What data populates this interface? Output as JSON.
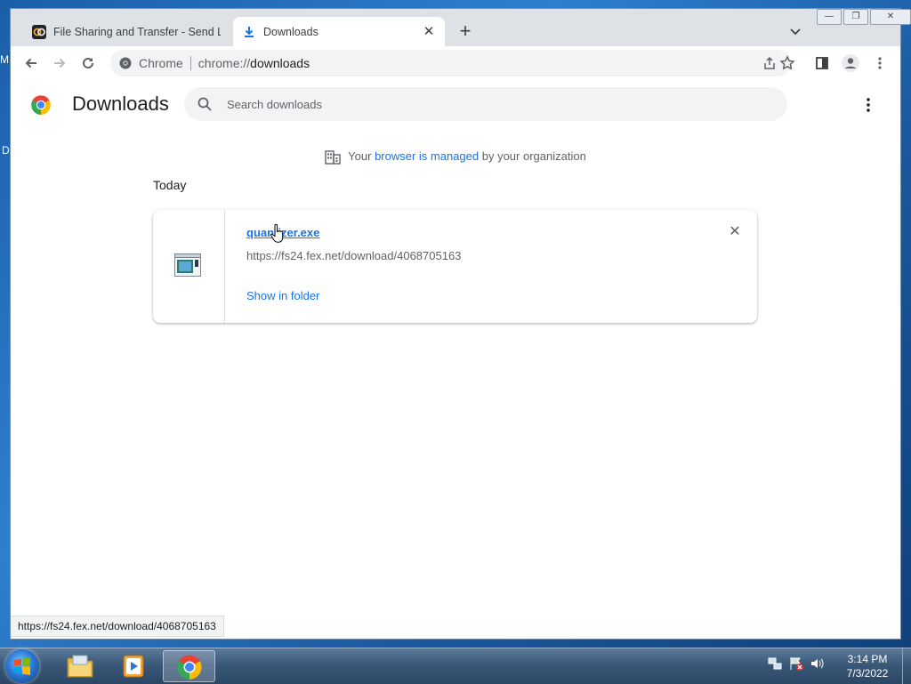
{
  "desktop": {
    "frag_top": "M",
    "frag_mid": "D"
  },
  "tabs": [
    {
      "title": "File Sharing and Transfer - Send L",
      "icon": "fex-logo-icon"
    },
    {
      "title": "Downloads",
      "icon": "download-icon"
    }
  ],
  "window_controls": {
    "minimize": "—",
    "restore": "❐",
    "close": "✕"
  },
  "omnibox": {
    "chip_label": "Chrome",
    "url_scheme": "chrome://",
    "url_path": "downloads"
  },
  "downloads_page": {
    "title": "Downloads",
    "search_placeholder": "Search downloads",
    "managed_prefix": "Your ",
    "managed_link": "browser is managed",
    "managed_suffix": " by your organization",
    "date_group": "Today",
    "items": [
      {
        "file_name": "quantizer.exe",
        "url": "https://fs24.fex.net/download/4068705163",
        "action_label": "Show in folder"
      }
    ]
  },
  "status_bubble": "https://fs24.fex.net/download/4068705163",
  "taskbar": {
    "apps": [
      "explorer-icon",
      "media-player-icon",
      "chrome-icon"
    ],
    "clock_time": "3:14 PM",
    "clock_date": "7/3/2022"
  },
  "colors": {
    "accent": "#1a73e8",
    "text": "#202124",
    "secondary": "#5f6368"
  }
}
